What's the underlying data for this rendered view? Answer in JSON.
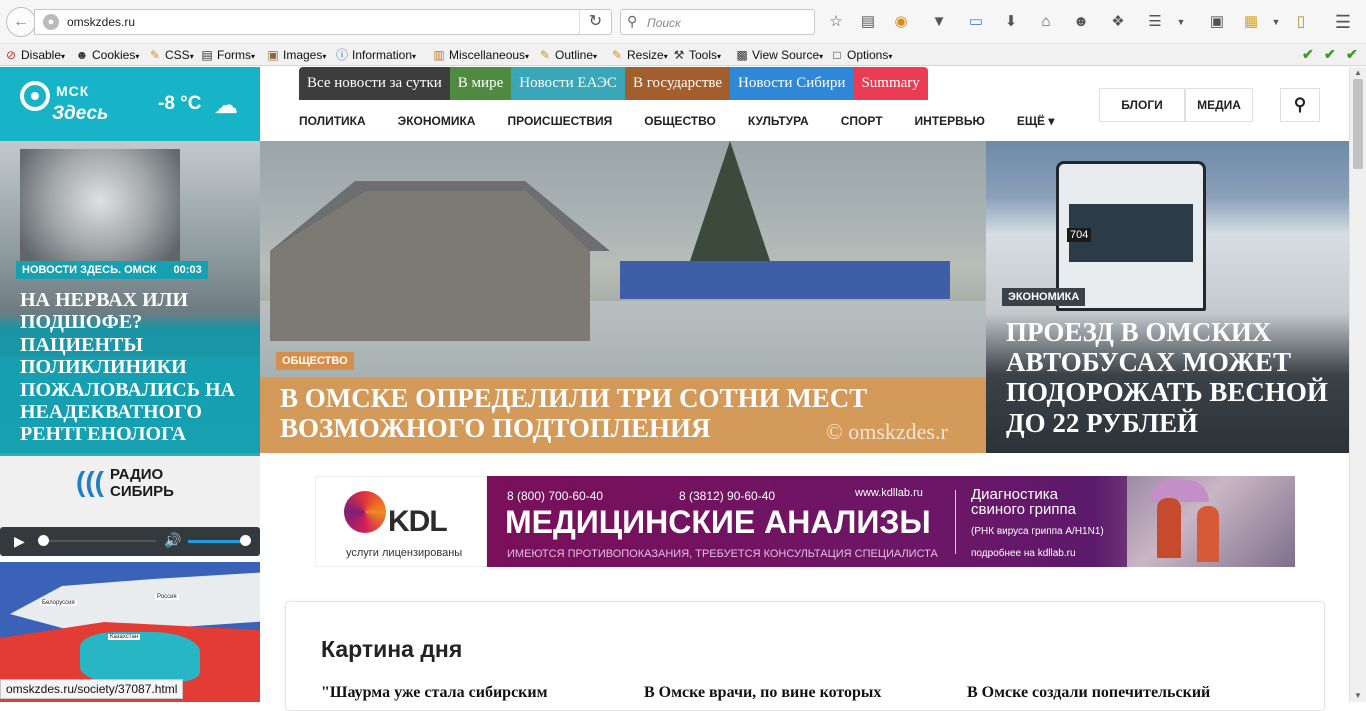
{
  "browser": {
    "url": "omskzdes.ru",
    "search_placeholder": "Поиск",
    "status_url": "omskzdes.ru/society/37087.html"
  },
  "devbar": [
    {
      "label": "Disable",
      "icon": "no-icon"
    },
    {
      "label": "Cookies",
      "icon": "person-icon"
    },
    {
      "label": "CSS",
      "icon": "pencil-icon"
    },
    {
      "label": "Forms",
      "icon": "form-icon"
    },
    {
      "label": "Images",
      "icon": "image-icon"
    },
    {
      "label": "Information",
      "icon": "info-icon"
    },
    {
      "label": "Miscellaneous",
      "icon": "folder-icon"
    },
    {
      "label": "Outline",
      "icon": "pencil-icon"
    },
    {
      "label": "Resize",
      "icon": "pencil-icon"
    },
    {
      "label": "Tools",
      "icon": "tools-icon"
    },
    {
      "label": "View Source",
      "icon": "source-icon"
    },
    {
      "label": "Options",
      "icon": "options-icon"
    }
  ],
  "site": {
    "logo_line1": "МСК",
    "logo_line2": "Здесь",
    "temperature": "-8 °C",
    "top_nav": [
      {
        "label": "Все новости за сутки",
        "color": "#3d3d3d"
      },
      {
        "label": "В мире",
        "color": "#4e8a3f"
      },
      {
        "label": "Новости ЕАЭС",
        "color": "#3aa7b8"
      },
      {
        "label": "В государстве",
        "color": "#a35e2d"
      },
      {
        "label": "Новости Сибири",
        "color": "#2f87d8"
      },
      {
        "label": "Summary",
        "color": "#ea3d55"
      }
    ],
    "categories": [
      "ПОЛИТИКА",
      "ЭКОНОМИКА",
      "ПРОИСШЕСТВИЯ",
      "ОБЩЕСТВО",
      "КУЛЬТУРА",
      "СПОРТ",
      "ИНТЕРВЬЮ",
      "ЕЩЁ"
    ],
    "blogs": "БЛОГИ",
    "media": "МЕДИА"
  },
  "stories": {
    "left": {
      "badge": "НОВОСТИ ЗДЕСЬ. ОМСК",
      "time": "00:03",
      "title": "На нервах или подшофе? Пациенты поликлиники пожаловались на неадекватного рентгенолога"
    },
    "center": {
      "badge": "ОБЩЕСТВО",
      "title": "В Омске определили три сотни мест возможного подтопления",
      "watermark": "© omskzdes.r"
    },
    "right": {
      "badge": "ЭКОНОМИКА",
      "title": "Проезд в омских автобусах может подорожать весной до 22 рублей",
      "bus_number": "704"
    }
  },
  "radio": {
    "name_line1": "РАДИО",
    "name_line2": "СИБИРЬ"
  },
  "map_labels": [
    "Белоруссия",
    "Россия",
    "Казахстан"
  ],
  "ad": {
    "brand": "KDL",
    "license": "услуги лицензированы",
    "phone1": "8 (800) 700-60-40",
    "phone2": "8 (3812) 90-60-40",
    "site": "www.kdllab.ru",
    "headline": "МЕДИЦИНСКИЕ АНАЛИЗЫ",
    "disclaimer": "ИМЕЮТСЯ ПРОТИВОПОКАЗАНИЯ, ТРЕБУЕТСЯ КОНСУЛЬТАЦИЯ СПЕЦИАЛИСТА",
    "diag_line1": "Диагностика",
    "diag_line2": "свиного гриппа",
    "rnk": "(РНК вируса гриппа A/H1N1)",
    "more": "подробнее на kdllab.ru"
  },
  "picture_of_day": {
    "title": "Картина дня",
    "items": [
      "\"Шаурма уже стала сибирским",
      "В Омске врачи, по вине которых",
      "В Омске создали попечительский"
    ]
  }
}
